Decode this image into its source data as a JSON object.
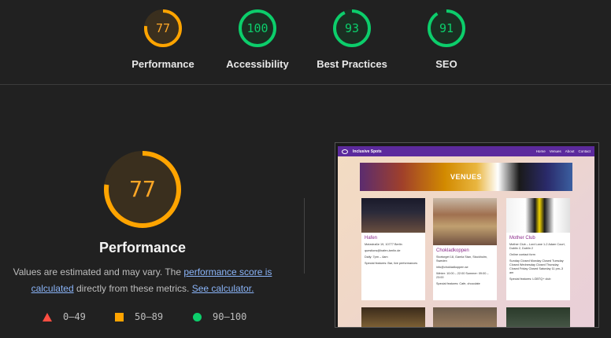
{
  "top_scores": [
    {
      "id": "performance",
      "label": "Performance",
      "score": "77",
      "value": 77,
      "color": "#ffa400",
      "text_color": "#ffa726",
      "fill": "#3a2f1e"
    },
    {
      "id": "accessibility",
      "label": "Accessibility",
      "score": "100",
      "value": 100,
      "color": "#0cce6b",
      "text_color": "#0cce6b",
      "fill": "#1b2e22"
    },
    {
      "id": "best-practices",
      "label": "Best Practices",
      "score": "93",
      "value": 93,
      "color": "#0cce6b",
      "text_color": "#0cce6b",
      "fill": "#1b2e22"
    },
    {
      "id": "seo",
      "label": "SEO",
      "score": "91",
      "value": 91,
      "color": "#0cce6b",
      "text_color": "#0cce6b",
      "fill": "#1b2e22"
    }
  ],
  "main": {
    "score": "77",
    "value": 77,
    "title": "Performance",
    "desc_prefix": "Values are estimated and may vary. The ",
    "desc_link": "performance score is calculated",
    "desc_middle": " directly from these metrics. ",
    "desc_link2": "See calculator."
  },
  "legend": [
    {
      "shape": "triangle",
      "range": "0–49",
      "color": "#ff4e42"
    },
    {
      "shape": "square",
      "range": "50–89",
      "color": "#ffa400"
    },
    {
      "shape": "circle",
      "range": "90–100",
      "color": "#0cce6b"
    }
  ],
  "thumbnail": {
    "brand": "Inclusive Spots",
    "nav_links": [
      "Home",
      "Venues",
      "About",
      "Contact"
    ],
    "banner": "VENUES",
    "cards": [
      {
        "name": "Hafen",
        "lines": [
          "Motzstraße 19, 10777 Berlin",
          "questions@hafen-berlin.de",
          "Daily: 7pm – 4am",
          "Special features: Bar, live performances"
        ]
      },
      {
        "name": "Chokladkoppen",
        "lines": [
          "Stortorget 18, Gamla Stan, Stockholm, Sweden",
          "info@chokladkoppen.se",
          "Winter: 10:00 – 22:00 Summer: 09:00 – 23:00",
          "Special features: Cafe, chocolate"
        ]
      },
      {
        "name": "Mother Club",
        "lines": [
          "Mother Club – Lord Lane 1-2 Adam Court, Dublin 2, Dublin 2",
          "Online contact form",
          "Sunday Closed Monday Closed Tuesday Closed Wednesday Closed Thursday Closed Friday Closed Saturday 11 pm–3 am",
          "Special features: LGBTQ+ club"
        ]
      }
    ]
  }
}
